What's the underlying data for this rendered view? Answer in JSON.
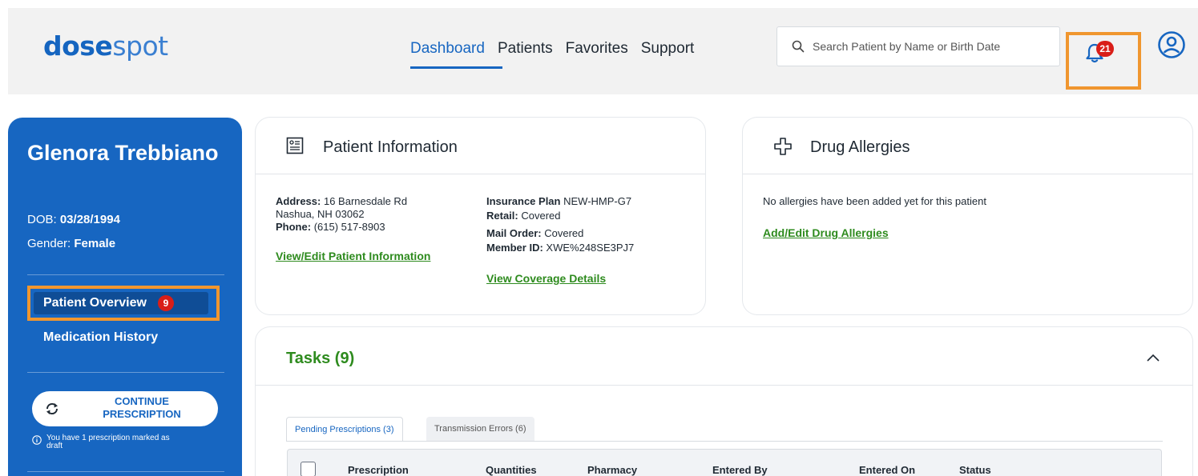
{
  "header": {
    "logo_bold": "dose",
    "logo_light": "spot",
    "nav": [
      {
        "label": "Dashboard",
        "active": true
      },
      {
        "label": "Patients",
        "active": false
      },
      {
        "label": "Favorites",
        "active": false
      },
      {
        "label": "Support",
        "active": false
      }
    ],
    "search_placeholder": "Search Patient by Name or Birth Date",
    "notifications_count": "21",
    "icons": {
      "search": "search-icon",
      "bell": "bell-icon",
      "avatar": "user-avatar-icon"
    }
  },
  "sidebar": {
    "patient_name": "Glenora Trebbiano",
    "dob_label": "DOB: ",
    "dob_value": "03/28/1994",
    "gender_label": "Gender: ",
    "gender_value": "Female",
    "overview_label": "Patient Overview",
    "overview_badge": "9",
    "med_history_label": "Medication History",
    "continue_label": "CONTINUE PRESCRIPTION",
    "draft_note": "You have 1 prescription marked as draft"
  },
  "patient_info": {
    "title": "Patient Information",
    "address_label": "Address:",
    "address_line1": "16 Barnesdale Rd",
    "address_line2": "Nashua, NH 03062",
    "phone_label": "Phone:",
    "phone_value": "(615) 517-8903",
    "view_edit_link": "View/Edit Patient Information",
    "insurance_label": "Insurance Plan",
    "insurance_value": "NEW-HMP-G7",
    "retail_label": "Retail:",
    "retail_value": "Covered",
    "mail_label": "Mail Order:",
    "mail_value": "Covered",
    "member_label": "Member ID:",
    "member_value": "XWE%248SE3PJ7",
    "coverage_link": "View Coverage Details"
  },
  "drug_allergies": {
    "title": "Drug Allergies",
    "empty_text": "No allergies have been added yet for this patient",
    "add_link": "Add/Edit Drug Allergies"
  },
  "tasks": {
    "title": "Tasks (9)",
    "tabs": [
      {
        "label": "Pending Prescriptions (3)",
        "active": true
      },
      {
        "label": "Transmission Errors (6)",
        "active": false
      }
    ],
    "columns": [
      "Prescription",
      "Quantities",
      "Pharmacy",
      "Entered By",
      "Entered On",
      "Status"
    ]
  },
  "colors": {
    "brand_blue": "#1766c1",
    "highlight_orange": "#f0962f",
    "badge_red": "#d91e18",
    "link_green": "#2e8b1e"
  }
}
